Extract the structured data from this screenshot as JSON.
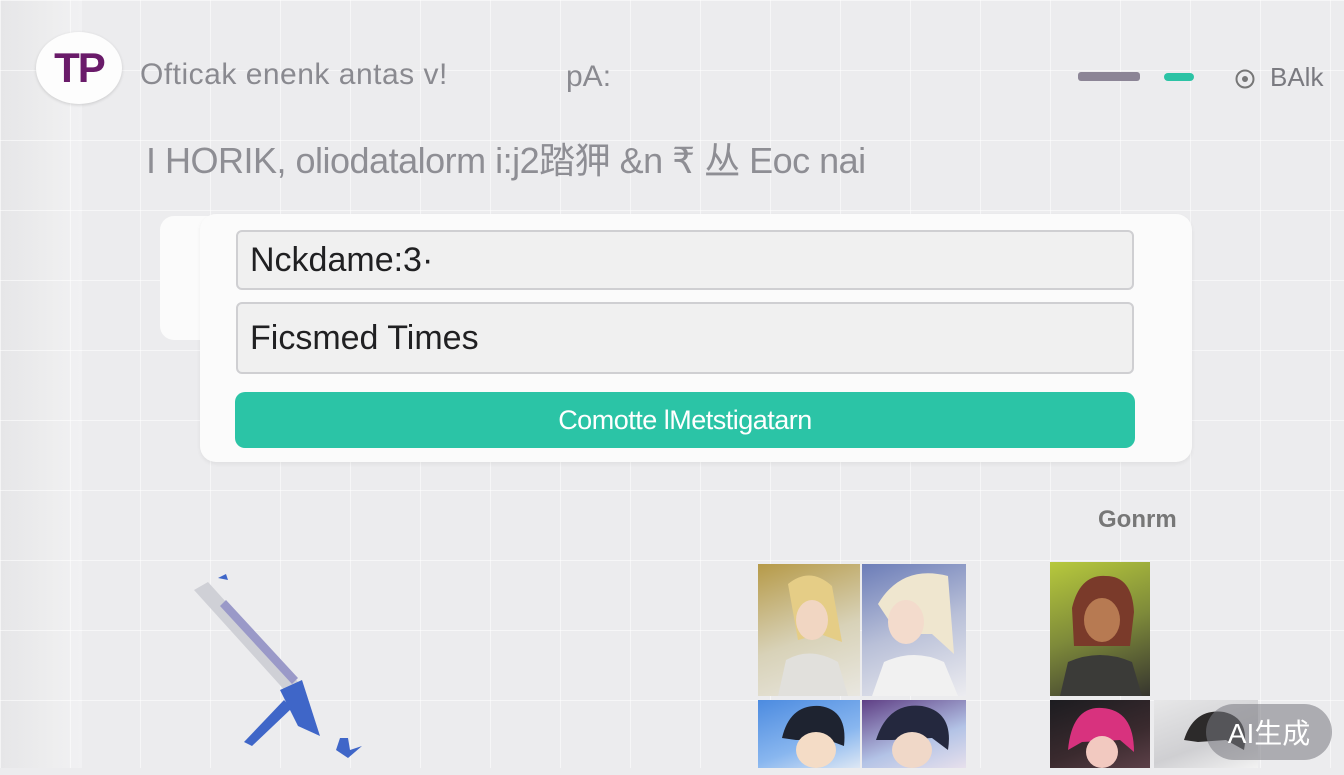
{
  "header": {
    "logo_text": "TP",
    "app_title": "Ofticak enenk antas v!",
    "app_suffix": "pA:",
    "right_label": "BAlk",
    "accent_color": "#2bc4a6",
    "brand_color": "#6a1b6a"
  },
  "subtitle": "I HORIK, oliodatalorm i:j2踏狎 &n  ₹ 丛 Eoc nai",
  "form": {
    "nickname_value": "Nckdame:3·",
    "field_two_value": "Ficsmed Times",
    "submit_label": "Comotte lMetstigatarn"
  },
  "gallery": {
    "section_label": "Gonrm",
    "avatars": [
      "avatar-1",
      "avatar-2",
      "avatar-3",
      "avatar-4",
      "avatar-5",
      "avatar-6",
      "avatar-7"
    ]
  },
  "watermark": "AI生成",
  "icons": {
    "header_icon": "circle-eye-icon",
    "illustration": "pencil-arrow-illustration"
  }
}
